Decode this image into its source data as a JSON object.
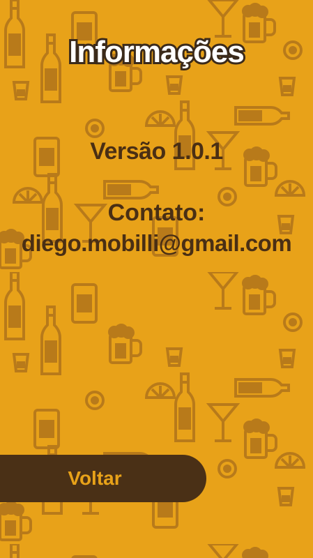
{
  "screen": {
    "title": "Informações",
    "version_text": "Versão 1.0.1",
    "contact_label": "Contato:",
    "contact_email": "diego.mobilli@gmail.com",
    "back_button_label": "Voltar"
  },
  "colors": {
    "background": "#E8A219",
    "pattern": "#B8791A",
    "text_dark": "#4a2f14",
    "button_bg": "#4a3016",
    "button_text": "#E8A219",
    "title_fill": "#ffffff"
  },
  "icons": {
    "background_pattern": [
      "beer-bottle-icon",
      "beer-mug-icon",
      "cocktail-glass-icon",
      "shot-glass-icon",
      "can-icon",
      "lemon-slice-icon",
      "bottle-cap-icon"
    ]
  }
}
